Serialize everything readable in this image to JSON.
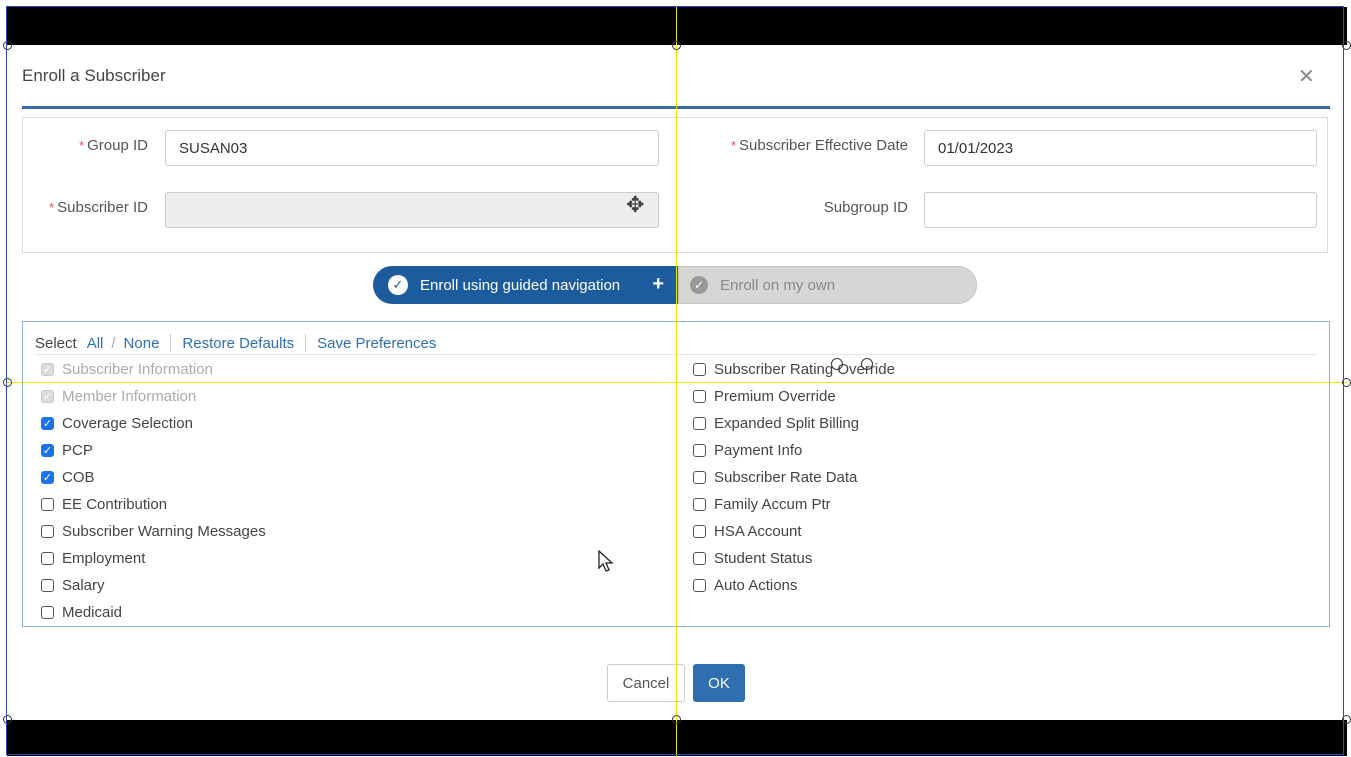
{
  "dialog": {
    "title": "Enroll a Subscriber",
    "close_glyph": "✕"
  },
  "form": {
    "required_mark": "*",
    "group_id": {
      "label": "Group ID",
      "value": "SUSAN03"
    },
    "subscriber_id": {
      "label": "Subscriber ID",
      "value": ""
    },
    "effective_date": {
      "label": "Subscriber Effective Date",
      "value": "01/01/2023"
    },
    "subgroup_id": {
      "label": "Subgroup ID",
      "value": ""
    }
  },
  "mode_toggle": {
    "guided": "Enroll using guided navigation",
    "guided_plus": "+",
    "own": "Enroll on my own",
    "selected": "guided"
  },
  "options": {
    "select_label": "Select",
    "all": "All",
    "slash": "/",
    "none": "None",
    "restore": "Restore Defaults",
    "save": "Save Preferences",
    "left": [
      {
        "label": "Subscriber Information",
        "state": "disabled"
      },
      {
        "label": "Member Information",
        "state": "disabled"
      },
      {
        "label": "Coverage Selection",
        "state": "checked"
      },
      {
        "label": "PCP",
        "state": "checked"
      },
      {
        "label": "COB",
        "state": "checked"
      },
      {
        "label": "EE Contribution",
        "state": "unchecked"
      },
      {
        "label": "Subscriber Warning Messages",
        "state": "unchecked"
      },
      {
        "label": "Employment",
        "state": "unchecked"
      },
      {
        "label": "Salary",
        "state": "unchecked"
      },
      {
        "label": "Medicaid",
        "state": "unchecked"
      }
    ],
    "right": [
      {
        "label": "Subscriber Rating Override",
        "state": "unchecked"
      },
      {
        "label": "Premium Override",
        "state": "unchecked"
      },
      {
        "label": "Expanded Split Billing",
        "state": "unchecked"
      },
      {
        "label": "Payment Info",
        "state": "unchecked"
      },
      {
        "label": "Subscriber Rate Data",
        "state": "unchecked"
      },
      {
        "label": "Family Accum Ptr",
        "state": "unchecked"
      },
      {
        "label": "HSA Account",
        "state": "unchecked"
      },
      {
        "label": "Student Status",
        "state": "unchecked"
      },
      {
        "label": "Auto Actions",
        "state": "unchecked"
      }
    ]
  },
  "buttons": {
    "cancel": "Cancel",
    "ok": "OK"
  },
  "icons": {
    "close": "close-icon",
    "check": "check-circle-icon",
    "plus": "plus-icon",
    "move": "move-cursor-icon",
    "pointer": "mouse-pointer-icon"
  }
}
